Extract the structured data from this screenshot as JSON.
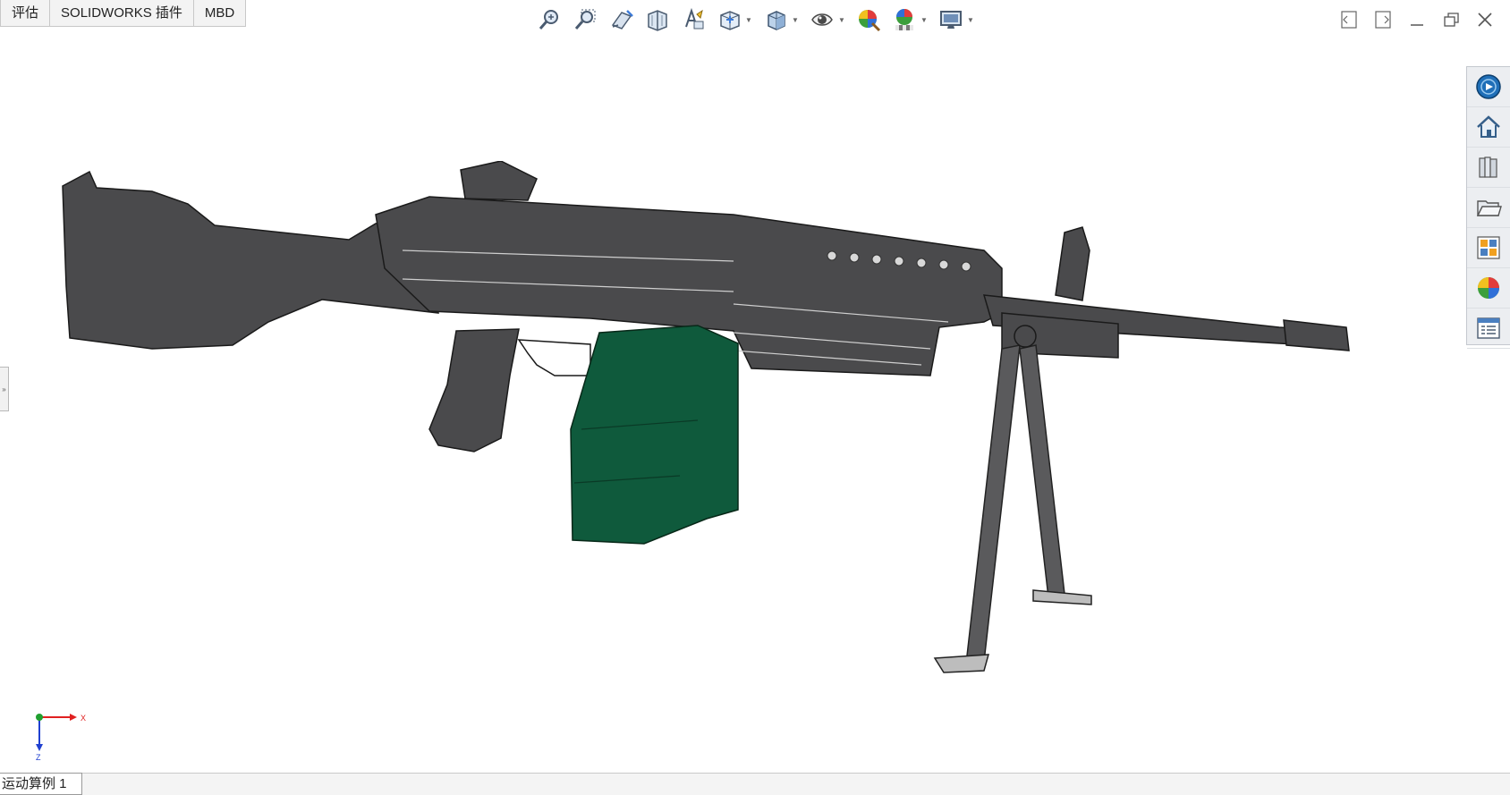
{
  "command_tabs": [
    "评估",
    "SOLIDWORKS 插件",
    "MBD"
  ],
  "hud_tools": [
    {
      "icon": "zoom-to-fit-icon",
      "dropdown": false
    },
    {
      "icon": "zoom-to-area-icon",
      "dropdown": false
    },
    {
      "icon": "previous-view-icon",
      "dropdown": false
    },
    {
      "icon": "section-view-icon",
      "dropdown": false
    },
    {
      "icon": "dynamic-annotation-views-icon",
      "dropdown": false
    },
    {
      "icon": "view-orientation-icon",
      "dropdown": true
    },
    {
      "icon": "display-style-icon",
      "dropdown": true
    },
    {
      "icon": "hide-show-items-icon",
      "dropdown": true
    },
    {
      "icon": "edit-appearance-icon",
      "dropdown": false
    },
    {
      "icon": "apply-scene-icon",
      "dropdown": true
    },
    {
      "icon": "view-settings-icon",
      "dropdown": true
    }
  ],
  "task_pane": [
    "solidworks-resources-icon",
    "home-icon",
    "design-library-icon",
    "file-explorer-icon",
    "view-palette-icon",
    "appearances-scenes-icon",
    "custom-properties-icon"
  ],
  "colors": {
    "model_body": "#4a4a4c",
    "ammo_box": "#0f5a3c",
    "triad_x": "#e02020",
    "triad_z": "#2040d0",
    "triad_y": "#20a030"
  },
  "triad": {
    "x_label": "X",
    "z_label": "Z"
  },
  "bottom_tabs": [
    "运动算例 1"
  ]
}
